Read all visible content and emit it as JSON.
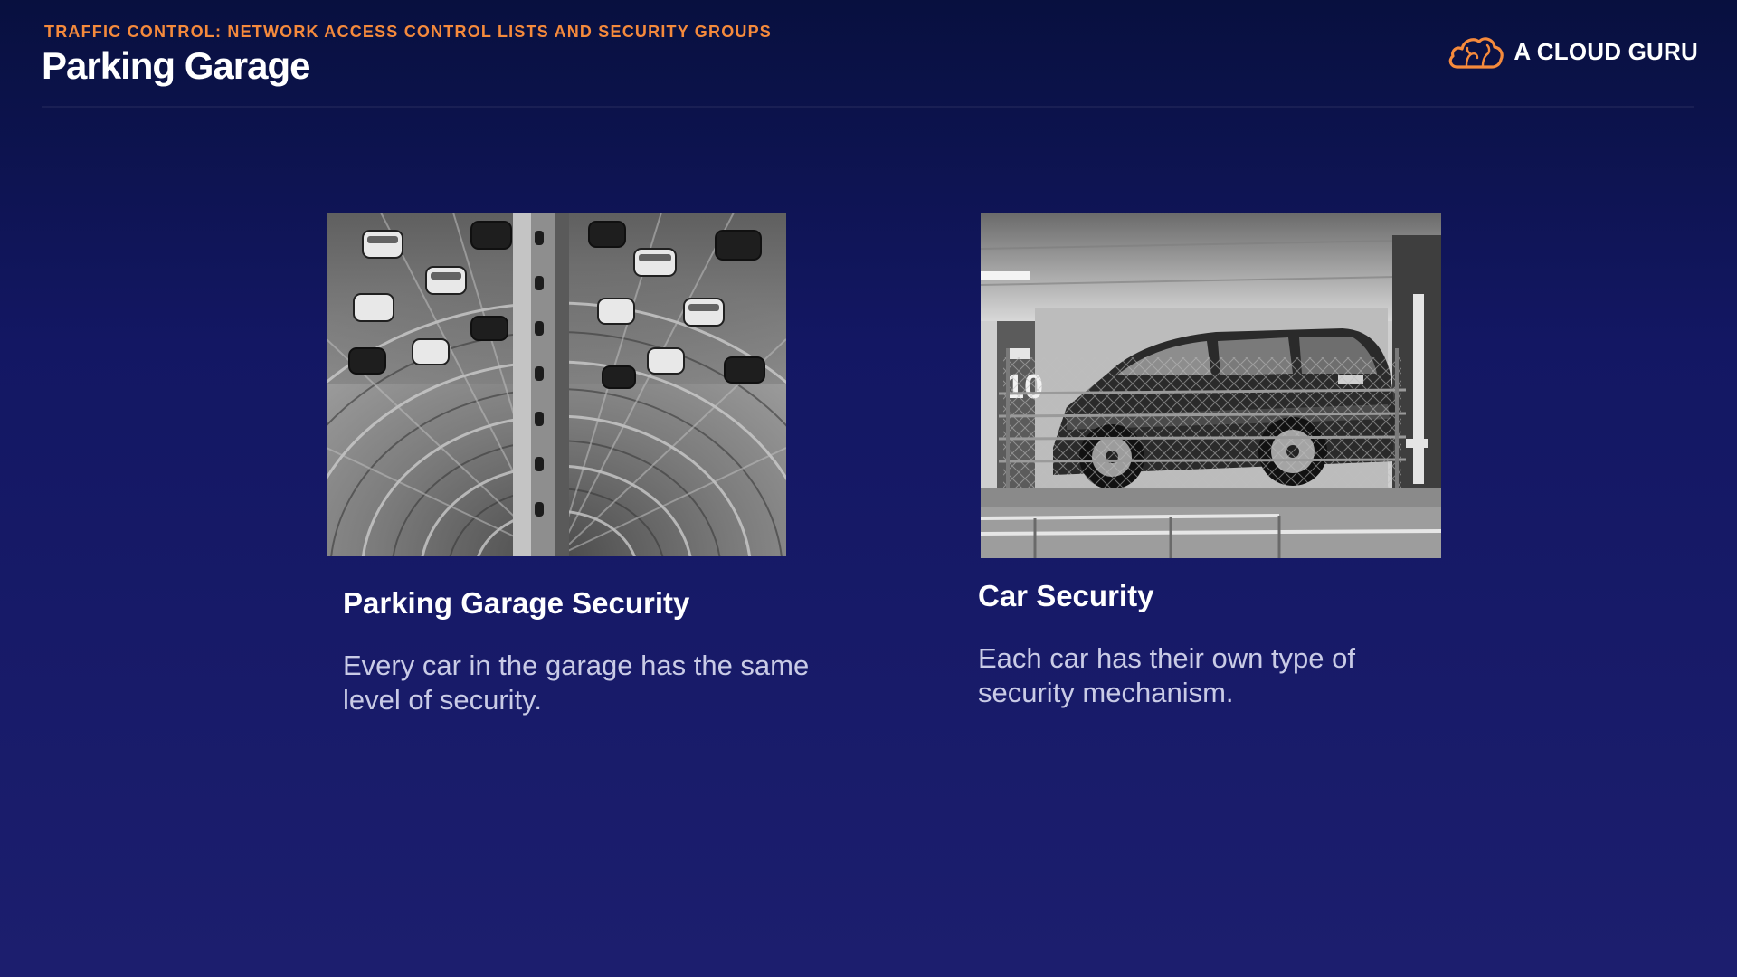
{
  "header": {
    "eyebrow": "TRAFFIC CONTROL: NETWORK ACCESS CONTROL LISTS AND SECURITY GROUPS",
    "title": "Parking Garage"
  },
  "brand": {
    "name": "A CLOUD GURU",
    "icon": "cloud-logo-icon",
    "accent_color": "#f58a3c"
  },
  "cards": [
    {
      "image": "parking-garage-tower-photo",
      "heading": "Parking Garage Security",
      "body": "Every car in the garage has the same level of security."
    },
    {
      "image": "suv-behind-fence-photo",
      "heading": "Car Security",
      "body": "Each car has their own type of security mechanism.",
      "photo_sign_text": "10"
    }
  ],
  "colors": {
    "background_top": "#08103f",
    "background_bottom": "#1c1e6e",
    "heading": "#ffffff",
    "body_text": "#c9cbe6"
  }
}
